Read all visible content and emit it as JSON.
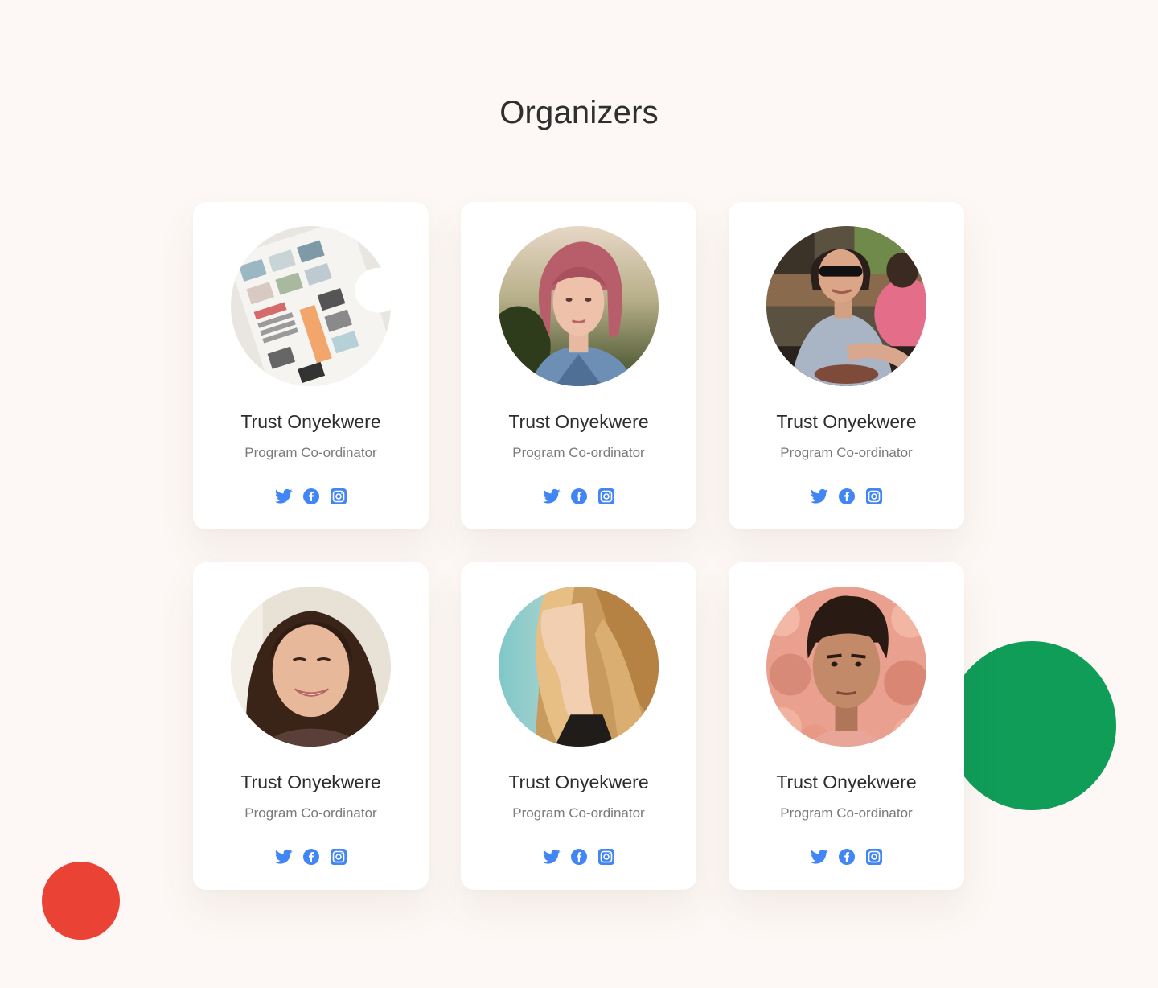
{
  "section": {
    "title": "Organizers"
  },
  "colors": {
    "background": "#fdf8f5",
    "accent_blue": "#4285f4",
    "decor_green": "#0f9d58",
    "decor_red": "#ea4335"
  },
  "organizers": [
    {
      "name": "Trust Onyekwere",
      "role": "Program Co-ordinator",
      "photo": "moodboard-photo"
    },
    {
      "name": "Trust Onyekwere",
      "role": "Program Co-ordinator",
      "photo": "pink-hair-woman-photo"
    },
    {
      "name": "Trust Onyekwere",
      "role": "Program Co-ordinator",
      "photo": "sunglasses-woman-photo"
    },
    {
      "name": "Trust Onyekwere",
      "role": "Program Co-ordinator",
      "photo": "smiling-woman-photo"
    },
    {
      "name": "Trust Onyekwere",
      "role": "Program Co-ordinator",
      "photo": "blonde-woman-photo"
    },
    {
      "name": "Trust Onyekwere",
      "role": "Program Co-ordinator",
      "photo": "man-roses-photo"
    }
  ],
  "social_icons": [
    "twitter-icon",
    "facebook-icon",
    "instagram-icon"
  ]
}
